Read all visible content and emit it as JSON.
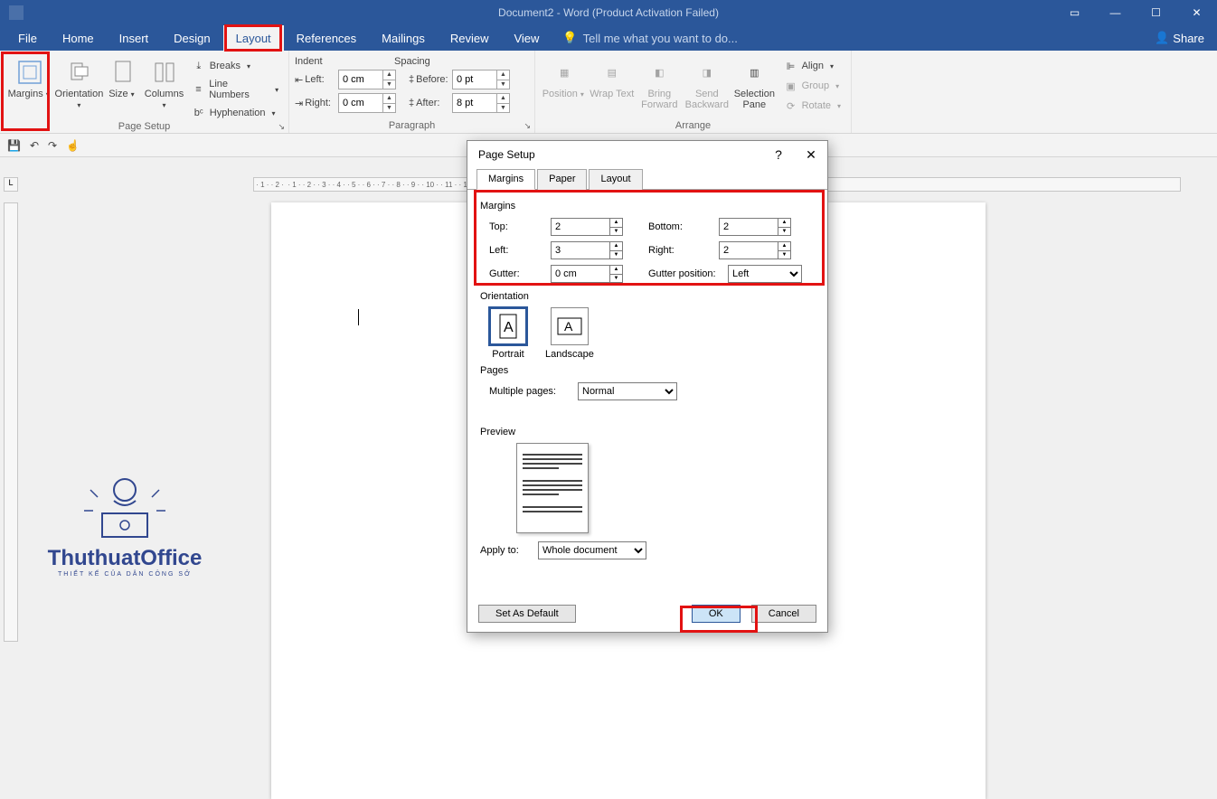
{
  "titlebar": {
    "title": "Document2 - Word (Product Activation Failed)"
  },
  "window_controls": {
    "ribbon_opts": "▫",
    "min": "—",
    "max": "☐",
    "close": "✕"
  },
  "menubar": {
    "tabs": [
      "File",
      "Home",
      "Insert",
      "Design",
      "Layout",
      "References",
      "Mailings",
      "Review",
      "View"
    ],
    "active": "Layout",
    "tellme": "Tell me what you want to do...",
    "share": "Share"
  },
  "ribbon": {
    "page_setup": {
      "label": "Page Setup",
      "margins": "Margins",
      "orientation": "Orientation",
      "size": "Size",
      "columns": "Columns",
      "breaks": "Breaks",
      "line_numbers": "Line Numbers",
      "hyphenation": "Hyphenation"
    },
    "paragraph": {
      "label": "Paragraph",
      "indent": "Indent",
      "spacing": "Spacing",
      "left": "Left:",
      "right": "Right:",
      "before": "Before:",
      "after": "After:",
      "left_val": "0 cm",
      "right_val": "0 cm",
      "before_val": "0 pt",
      "after_val": "8 pt"
    },
    "arrange": {
      "label": "Arrange",
      "position": "Position",
      "wrap_text": "Wrap\nText",
      "bring_forward": "Bring\nForward",
      "send_backward": "Send\nBackward",
      "selection_pane": "Selection\nPane",
      "align": "Align",
      "group": "Group",
      "rotate": "Rotate"
    }
  },
  "dialog": {
    "title": "Page Setup",
    "tabs": [
      "Margins",
      "Paper",
      "Layout"
    ],
    "active_tab": "Margins",
    "margins_section": "Margins",
    "top_lbl": "Top:",
    "top_val": "2",
    "bottom_lbl": "Bottom:",
    "bottom_val": "2",
    "left_lbl": "Left:",
    "left_val": "3",
    "right_lbl": "Right:",
    "right_val": "2",
    "gutter_lbl": "Gutter:",
    "gutter_val": "0 cm",
    "gutter_pos_lbl": "Gutter position:",
    "gutter_pos_val": "Left",
    "orientation_lbl": "Orientation",
    "portrait": "Portrait",
    "landscape": "Landscape",
    "pages_lbl": "Pages",
    "multiple_pages_lbl": "Multiple pages:",
    "multiple_pages_val": "Normal",
    "preview_lbl": "Preview",
    "apply_to_lbl": "Apply to:",
    "apply_to_val": "Whole document",
    "set_default": "Set As Default",
    "ok": "OK",
    "cancel": "Cancel",
    "help": "?",
    "close": "✕"
  },
  "watermark": {
    "name": "ThuthuatOffice",
    "sub": "THIẾT KẾ CỦA DÂN CÔNG SỞ"
  }
}
